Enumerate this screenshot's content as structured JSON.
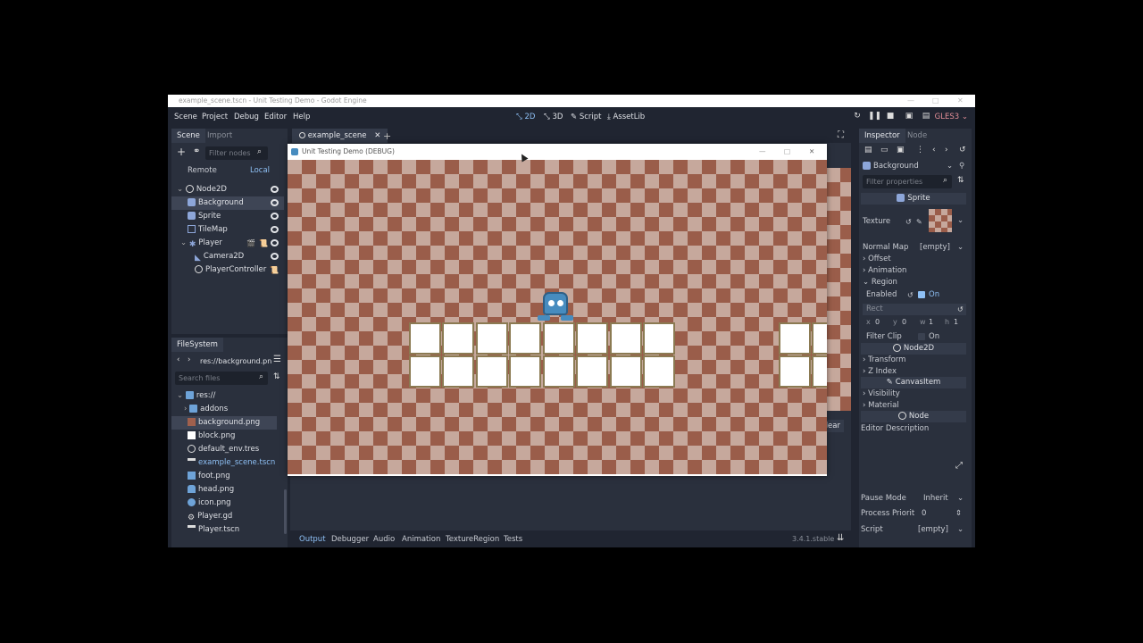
{
  "window": {
    "title": "example_scene.tscn - Unit Testing Demo - Godot Engine"
  },
  "menu": [
    "Scene",
    "Project",
    "Debug",
    "Editor",
    "Help"
  ],
  "workspaces": [
    {
      "label": "2D",
      "active": true
    },
    {
      "label": "3D",
      "active": false
    },
    {
      "label": "Script",
      "active": false
    },
    {
      "label": "AssetLib",
      "active": false
    }
  ],
  "renderer": "GLES3",
  "scene_dock": {
    "tabs": [
      "Scene",
      "Import"
    ],
    "filter_placeholder": "Filter nodes",
    "remote_label": "Remote",
    "local_label": "Local",
    "nodes": [
      {
        "label": "Node2D"
      },
      {
        "label": "Background"
      },
      {
        "label": "Sprite"
      },
      {
        "label": "TileMap"
      },
      {
        "label": "Player"
      },
      {
        "label": "Camera2D"
      },
      {
        "label": "PlayerController"
      }
    ]
  },
  "filesystem": {
    "title": "FileSystem",
    "path": "res://background.pn",
    "search_placeholder": "Search files",
    "items": [
      {
        "label": "res://"
      },
      {
        "label": "addons"
      },
      {
        "label": "background.png"
      },
      {
        "label": "block.png"
      },
      {
        "label": "default_env.tres"
      },
      {
        "label": "example_scene.tscn"
      },
      {
        "label": "foot.png"
      },
      {
        "label": "head.png"
      },
      {
        "label": "icon.png"
      },
      {
        "label": "Player.gd"
      },
      {
        "label": "Player.tscn"
      }
    ]
  },
  "editor_tab": {
    "label": "example_scene"
  },
  "game_window": {
    "title": "Unit Testing Demo (DEBUG)"
  },
  "bottom_panel": {
    "tabs": [
      "Output",
      "Debugger",
      "Audio",
      "Animation",
      "TextureRegion",
      "Tests"
    ],
    "version": "3.4.1.stable",
    "clear_label": "Clear"
  },
  "inspector": {
    "tabs": [
      "Inspector",
      "Node"
    ],
    "object": "Background",
    "filter_placeholder": "Filter properties",
    "sprite_section": "Sprite",
    "texture_label": "Texture",
    "normal_map_label": "Normal Map",
    "normal_map_value": "[empty]",
    "offset_label": "Offset",
    "animation_label": "Animation",
    "region_label": "Region",
    "enabled_label": "Enabled",
    "enabled_value": "On",
    "rect_label": "Rect",
    "rect": {
      "x_label": "x",
      "x": "0",
      "y_label": "y",
      "y": "0",
      "w_label": "w",
      "w": "1",
      "h_label": "h",
      "h": "1"
    },
    "filter_clip_label": "Filter Clip",
    "filter_clip_value": "On",
    "node2d_section": "Node2D",
    "transform_label": "Transform",
    "zindex_label": "Z Index",
    "canvasitem_section": "CanvasItem",
    "visibility_label": "Visibility",
    "material_label": "Material",
    "node_section": "Node",
    "editor_description_label": "Editor Description",
    "pause_mode_label": "Pause Mode",
    "pause_mode_value": "Inherit",
    "process_priority_label": "Process Priorit",
    "process_priority_value": "0",
    "script_label": "Script",
    "script_value": "[empty]"
  },
  "colors": {
    "accent": "#8ec0f5",
    "renderer": "#e38e97",
    "panel": "#2a303d",
    "bg": "#202531"
  }
}
